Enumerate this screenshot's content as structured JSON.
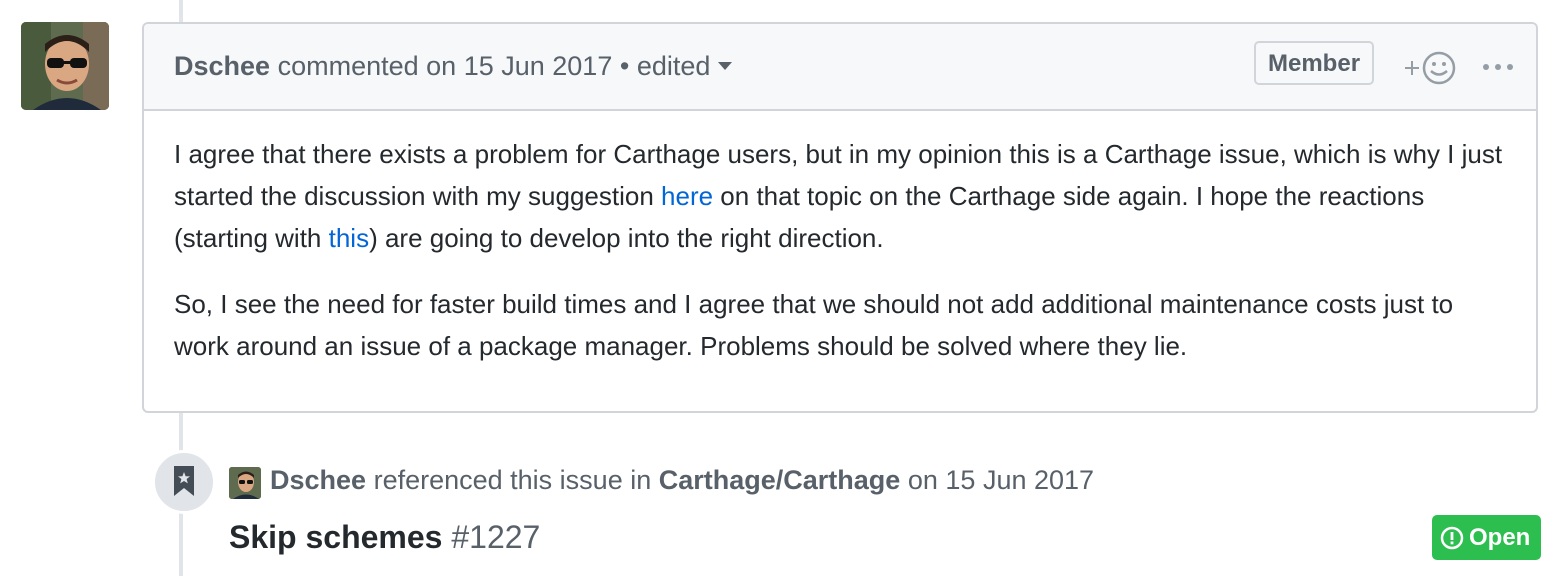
{
  "comment": {
    "author": "Dschee",
    "action": "commented on",
    "date": "15 Jun 2017",
    "separator": "•",
    "edited_label": "edited",
    "role_badge": "Member",
    "body": {
      "p1_part1": "I agree that there exists a problem for Carthage users, but in my opinion this is a Carthage issue, which is why I just started the discussion with my suggestion ",
      "p1_link1": "here",
      "p1_part2": " on that topic on the Carthage side again. I hope the reactions (starting with ",
      "p1_link2": "this",
      "p1_part3": ") are going to develop into the right direction.",
      "p2": "So, I see the need for faster build times and I agree that we should not add additional maintenance costs just to work around an issue of a package manager. Problems should be solved where they lie."
    }
  },
  "reference_event": {
    "author": "Dschee",
    "action": "referenced this issue in",
    "repository": "Carthage/Carthage",
    "date_prefix": "on",
    "date": "15 Jun 2017",
    "issue_title": "Skip schemes",
    "issue_number": "#1227",
    "status": "Open"
  },
  "icons": {
    "reaction": "add-reaction-icon",
    "more": "kebab-horizontal-icon",
    "bookmark": "bookmark-icon",
    "status": "issue-opened-icon"
  },
  "colors": {
    "link": "#0366d6",
    "open_status": "#2cbe4e",
    "header_bg": "#f6f8fa",
    "border": "#d1d5da"
  }
}
